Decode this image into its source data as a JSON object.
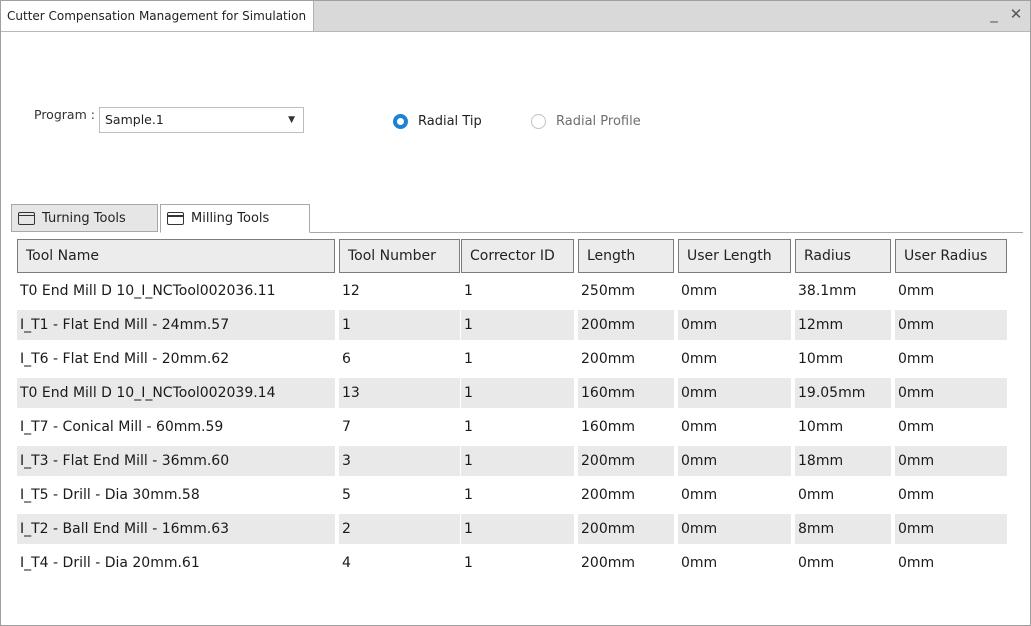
{
  "window": {
    "title": "Cutter Compensation Management for Simulation",
    "minimize_glyph": "_",
    "close_glyph": "✕"
  },
  "program": {
    "label": "Program :",
    "selected": "Sample.1"
  },
  "radios": {
    "tip_label": "Radial Tip",
    "profile_label": "Radial Profile",
    "selected": "Radial Tip"
  },
  "tabs": {
    "turning": "Turning Tools",
    "milling": "Milling Tools",
    "active": "Milling Tools"
  },
  "table": {
    "headers": [
      "Tool Name",
      "Tool Number",
      "Corrector ID",
      "Length",
      "User Length",
      "Radius",
      "User Radius"
    ],
    "rows": [
      [
        "T0 End Mill D 10_I_NCTool002036.11",
        "12",
        "1",
        "250mm",
        "0mm",
        "38.1mm",
        "0mm"
      ],
      [
        "I_T1 - Flat End Mill - 24mm.57",
        "1",
        "1",
        "200mm",
        "0mm",
        "12mm",
        "0mm"
      ],
      [
        "I_T6 - Flat End Mill - 20mm.62",
        "6",
        "1",
        "200mm",
        "0mm",
        "10mm",
        "0mm"
      ],
      [
        "T0 End Mill D 10_I_NCTool002039.14",
        "13",
        "1",
        "160mm",
        "0mm",
        "19.05mm",
        "0mm"
      ],
      [
        "I_T7 - Conical Mill - 60mm.59",
        "7",
        "1",
        "160mm",
        "0mm",
        "10mm",
        "0mm"
      ],
      [
        "I_T3 - Flat End Mill - 36mm.60",
        "3",
        "1",
        "200mm",
        "0mm",
        "18mm",
        "0mm"
      ],
      [
        "I_T5 - Drill - Dia 30mm.58",
        "5",
        "1",
        "200mm",
        "0mm",
        "0mm",
        "0mm"
      ],
      [
        "I_T2 - Ball End Mill - 16mm.63",
        "2",
        "1",
        "200mm",
        "0mm",
        "8mm",
        "0mm"
      ],
      [
        "I_T4 - Drill - Dia 20mm.61",
        "4",
        "1",
        "200mm",
        "0mm",
        "0mm",
        "0mm"
      ]
    ]
  }
}
